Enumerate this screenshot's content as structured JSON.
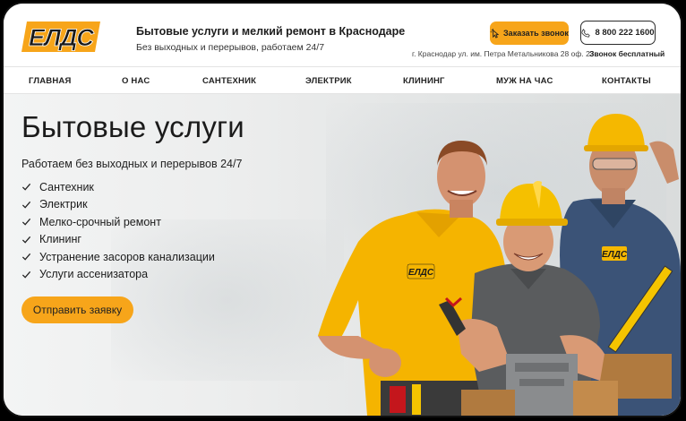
{
  "header": {
    "logo_text": "ЕЛДС",
    "title": "Бытовые услуги и мелкий ремонт в Краснодаре",
    "subtitle": "Без выходных и перерывов, работаем 24/7",
    "callback_label": "Заказать звонок",
    "phone": "8 800 222 1600",
    "address": "г. Краснодар ул. им. Петра Метальникова 28 оф. 23",
    "free_call": "Звонок бесплатный"
  },
  "nav": {
    "items": [
      "ГЛАВНАЯ",
      "О НАС",
      "САНТЕХНИК",
      "ЭЛЕКТРИК",
      "КЛИНИНГ",
      "МУЖ НА ЧАС",
      "КОНТАКТЫ"
    ]
  },
  "hero": {
    "title": "Бытовые услуги",
    "subtitle": "Работаем без выходных и перерывов 24/7",
    "services": [
      "Сантехник",
      "Электрик",
      "Мелко-срочный ремонт",
      "Клининг",
      "Устранение засоров канализации",
      "Услуги ассенизатора"
    ],
    "cta_label": "Отправить заявку",
    "shirt_logo": "ЕЛДС"
  },
  "colors": {
    "accent": "#f7a51a",
    "text": "#1d1d1d",
    "helmet": "#f5b800"
  },
  "icons": {
    "callback": "cursor-click-icon",
    "phone": "phone-icon",
    "list_bullet": "checkmark-icon"
  }
}
